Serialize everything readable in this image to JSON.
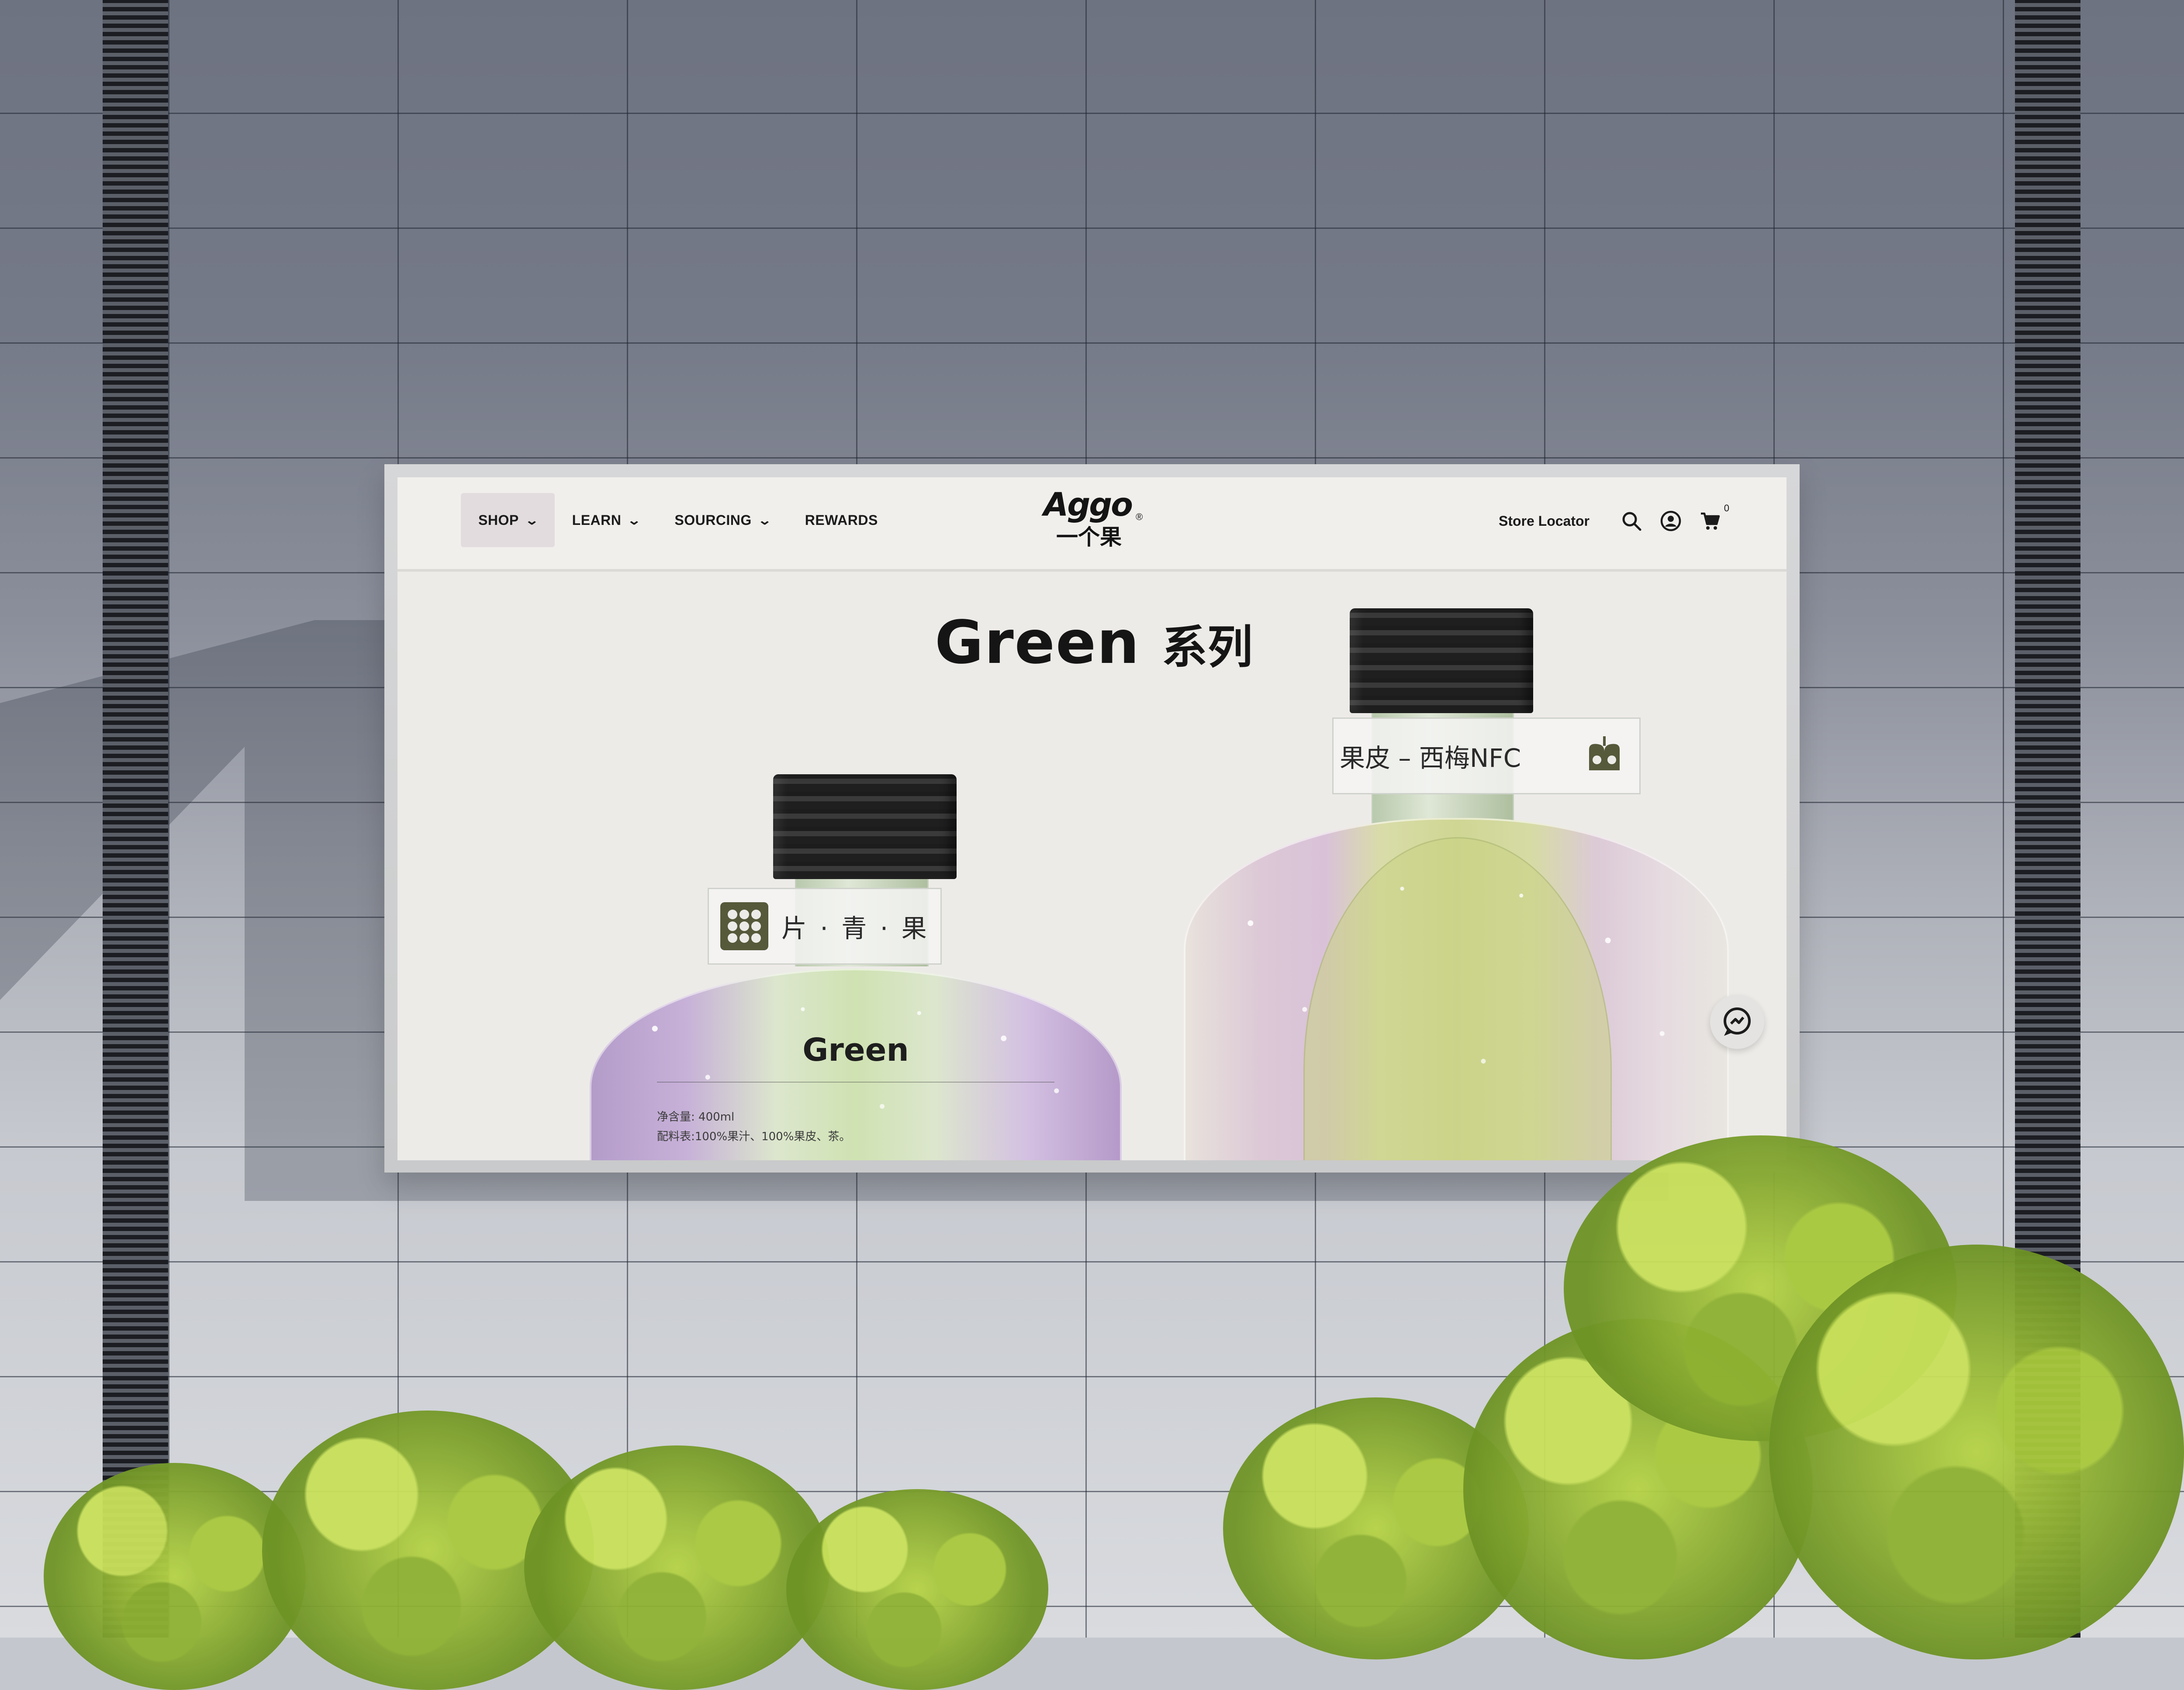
{
  "nav": {
    "items": [
      {
        "label": "SHOP",
        "has_dropdown": true,
        "active": true
      },
      {
        "label": "LEARN",
        "has_dropdown": true,
        "active": false
      },
      {
        "label": "SOURCING",
        "has_dropdown": true,
        "active": false
      },
      {
        "label": "REWARDS",
        "has_dropdown": false,
        "active": false
      }
    ],
    "dropdown_icon": "chevron-down-icon"
  },
  "logo": {
    "wordmark": "Aggo",
    "chinese": "一个果",
    "registered": "®"
  },
  "utility": {
    "store_locator": "Store Locator",
    "search_icon": "search-icon",
    "account_icon": "user-circle-icon",
    "cart_icon": "cart-icon",
    "cart_count": "0"
  },
  "hero": {
    "title_en": "Green",
    "title_cn": "系列"
  },
  "bottle_left": {
    "neck_label": "片 · 青 · 果",
    "body_word": "Green",
    "net_content": "净含量: 400ml",
    "ingredients": "配料表:100%果汁、100%果皮、茶。"
  },
  "bottle_right": {
    "neck_label": "果皮 – 西梅NFC"
  },
  "chat": {
    "icon": "chat-bubble-icon"
  },
  "colors": {
    "ink": "#151515",
    "active_nav_bg": "#e2dcdf",
    "screen_bg": "#edebe8",
    "badge": "#56593a"
  }
}
